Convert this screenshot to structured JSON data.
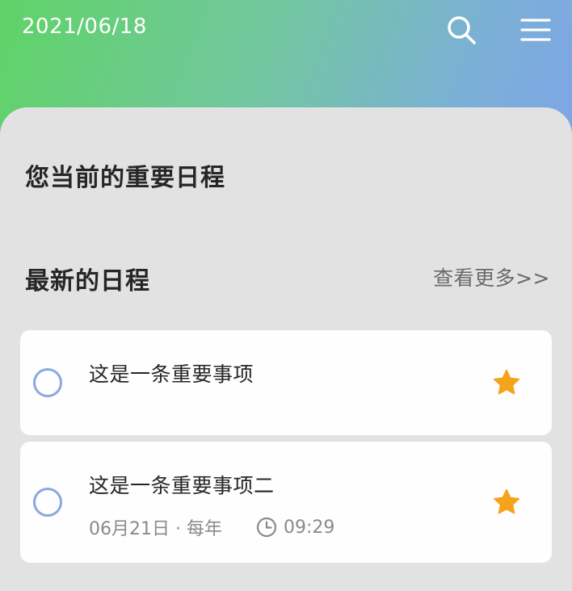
{
  "header": {
    "date": "2021/06/18",
    "search_icon": "search-icon",
    "menu_icon": "menu-icon",
    "gradient_colors": [
      "#5fd366",
      "#72c79e",
      "#7bb0d6",
      "#7ea6e6"
    ]
  },
  "important_section": {
    "title": "您当前的重要日程"
  },
  "latest_section": {
    "title": "最新的日程",
    "more_link": "查看更多>>"
  },
  "tasks": [
    {
      "title": "这是一条重要事项",
      "starred": true,
      "completed": false
    },
    {
      "title": "这是一条重要事项二",
      "date_repeat": "06月21日 · 每年",
      "time": "09:29",
      "starred": true,
      "completed": false
    }
  ],
  "colors": {
    "star": "#f5a31b",
    "checkbox": "#8aa8e0",
    "background": "#e2e2e2",
    "card": "#fefefe"
  }
}
